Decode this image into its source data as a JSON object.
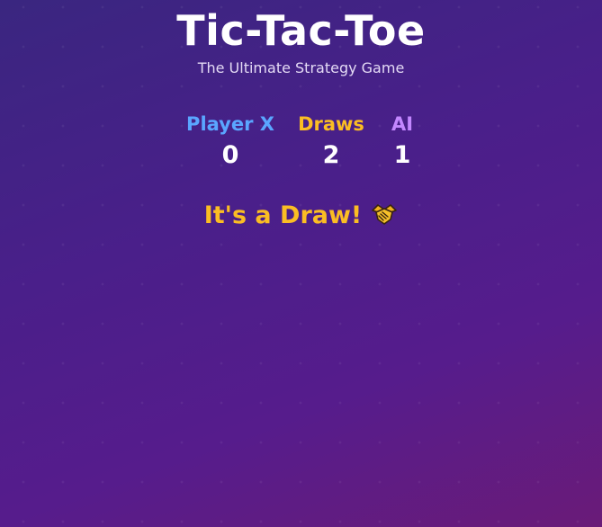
{
  "header": {
    "title": "Tic-Tac-Toe",
    "subtitle": "The Ultimate Strategy Game"
  },
  "scoreboard": {
    "player_x": {
      "label": "Player X",
      "value": "0",
      "color": "#5aa6ff"
    },
    "draws": {
      "label": "Draws",
      "value": "2",
      "color": "#fbbd23"
    },
    "ai": {
      "label": "AI",
      "value": "1",
      "color": "#c387ff"
    }
  },
  "status": {
    "text": "It's a Draw!",
    "icon": "handshake-icon",
    "color": "#fbbd23"
  }
}
